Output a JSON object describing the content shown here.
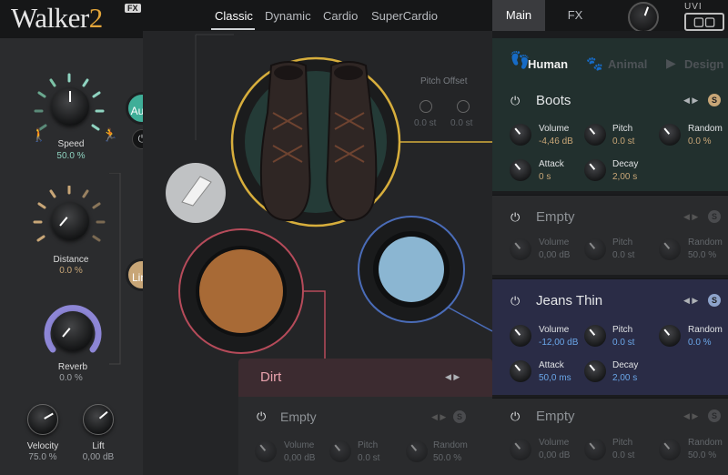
{
  "header": {
    "logo_text": "Walker",
    "logo_number": "2",
    "logo_badge": "FX",
    "modes": [
      "Classic",
      "Dynamic",
      "Cardio",
      "SuperCardio"
    ],
    "active_mode": "Classic",
    "page_tabs": [
      "Main",
      "FX"
    ],
    "active_page_tab": "Main",
    "brand": "UVI"
  },
  "left": {
    "speed": {
      "label": "Speed",
      "value": "50.0 %"
    },
    "auto_label": "Auto",
    "distance": {
      "label": "Distance",
      "value": "0.0 %"
    },
    "link_label": "Link",
    "reverb": {
      "label": "Reverb",
      "value": "0.0 %"
    },
    "velocity": {
      "label": "Velocity",
      "value": "75.0 %"
    },
    "lift": {
      "label": "Lift",
      "value": "0,00 dB"
    }
  },
  "center": {
    "pitch_offset_label": "Pitch Offset",
    "pitch_offset_a": "0.0 st",
    "pitch_offset_b": "0.0 st",
    "surface_name": "Dirt",
    "surface_slot": {
      "title": "Empty",
      "params": [
        {
          "label": "Volume",
          "value": "0,00 dB"
        },
        {
          "label": "Pitch",
          "value": "0.0 st"
        },
        {
          "label": "Random",
          "value": "50.0 %"
        }
      ]
    }
  },
  "right": {
    "categories": [
      "Human",
      "Animal",
      "Design"
    ],
    "active_category": "Human",
    "slots": [
      {
        "title": "Boots",
        "volume": "-4,46 dB",
        "pitch": "0.0 st",
        "random": "0.0 %",
        "attack": "0 s",
        "decay": "2,00 s",
        "badge": "S"
      },
      {
        "title": "Empty",
        "volume": "0,00 dB",
        "pitch": "0.0 st",
        "random": "50.0 %",
        "badge": "S"
      },
      {
        "title": "Jeans Thin",
        "volume": "-12,00 dB",
        "pitch": "0.0 st",
        "random": "0.0 %",
        "attack": "50,0 ms",
        "decay": "2,00 s",
        "badge": "S"
      },
      {
        "title": "Empty",
        "volume": "0,00 dB",
        "pitch": "0.0 st",
        "random": "50.0 %",
        "badge": "S"
      }
    ],
    "param_labels": {
      "volume": "Volume",
      "pitch": "Pitch",
      "random": "Random",
      "attack": "Attack",
      "decay": "Decay"
    }
  },
  "colors": {
    "teal": "#3fae98",
    "gold": "#c8a677",
    "blue": "#6aa6e8",
    "dirt_ring": "#b64b5a",
    "jeans_ring": "#4a6cb8",
    "reverb_ring": "#8d86d6"
  }
}
